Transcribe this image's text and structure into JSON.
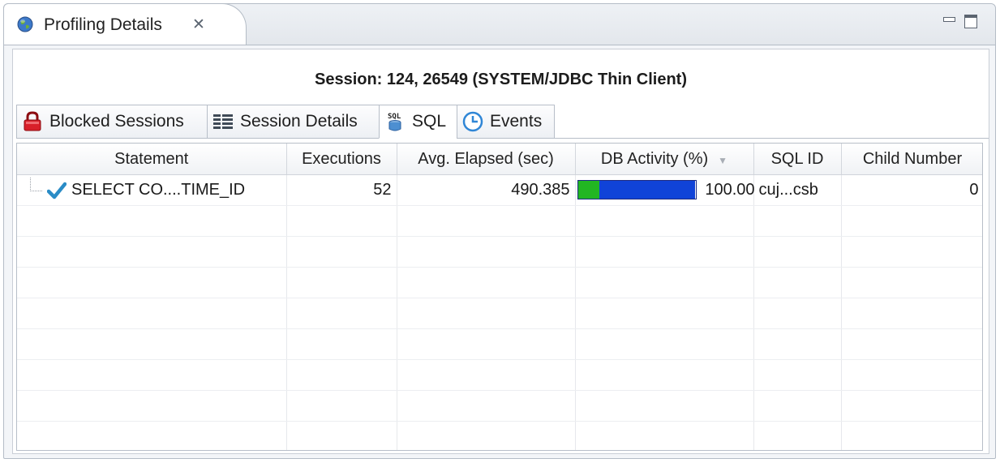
{
  "view": {
    "title": "Profiling Details",
    "close_glyph": "✕",
    "icons": [
      "globe-icon",
      "close-icon",
      "minimize-icon",
      "maximize-icon"
    ]
  },
  "session": {
    "title": "Session: 124, 26549 (SYSTEM/JDBC Thin Client)"
  },
  "tabs": [
    {
      "label": "Blocked Sessions",
      "icon": "blocked-sessions-icon"
    },
    {
      "label": "Session Details",
      "icon": "session-details-icon"
    },
    {
      "label": "SQL",
      "icon": "sql-icon",
      "active": true
    },
    {
      "label": "Events",
      "icon": "events-clock-icon"
    }
  ],
  "table": {
    "columns": [
      "Statement",
      "Executions",
      "Avg. Elapsed (sec)",
      "DB Activity (%)",
      "SQL ID",
      "Child Number"
    ],
    "sorted_column": "DB Activity (%)",
    "rows": [
      {
        "statement": "SELECT CO....TIME_ID",
        "executions": "52",
        "avg_elapsed": "490.385",
        "db_activity": "100.00",
        "db_activity_breakdown": [
          {
            "color": "#22b622",
            "fraction": 0.18
          },
          {
            "color": "#1043d8",
            "fraction": 0.82
          }
        ],
        "sql_id": "cuj...csb",
        "child_number": "0"
      }
    ]
  },
  "colors": {
    "cpu_green": "#22b622",
    "activity_blue": "#1043d8",
    "check_teal": "#2a8cc6"
  }
}
